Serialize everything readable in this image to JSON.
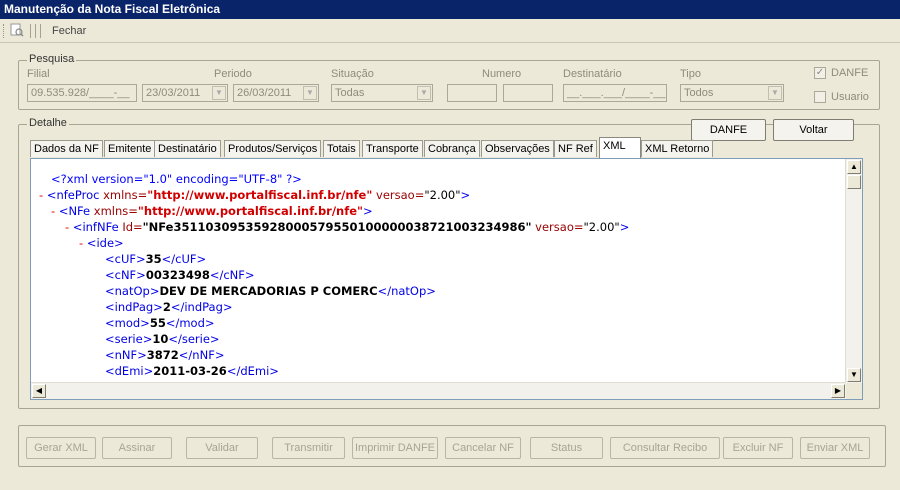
{
  "window": {
    "title": "Manutenção da Nota Fiscal Eletrônica"
  },
  "toolbar": {
    "close_label": "Fechar",
    "preview_icon": "print-preview-icon"
  },
  "pesquisa": {
    "legend": "Pesquisa",
    "filial_label": "Filial",
    "filial_value": "09.535.928/____-__",
    "periodo_label": "Periodo",
    "periodo_from": "23/03/2011",
    "periodo_to": "26/03/2011",
    "situacao_label": "Situação",
    "situacao_value": "Todas",
    "numero_label": "Numero",
    "numero_from": "",
    "numero_to": "",
    "destinatario_label": "Destinatário",
    "destinatario_value": "__.___.___/____-__",
    "tipo_label": "Tipo",
    "tipo_value": "Todos",
    "danfe_label": "DANFE",
    "danfe_checked": true,
    "usuario_label": "Usuario",
    "usuario_checked": false
  },
  "detalhe": {
    "legend": "Detalhe",
    "danfe_button": "DANFE",
    "voltar_button": "Voltar",
    "tabs": [
      "Dados da NF",
      "Emitente",
      "Destinatário",
      "Produtos/Serviços",
      "Totais",
      "Transporte",
      "Cobrança",
      "Observações",
      "NF Ref",
      "XML",
      "XML Retorno"
    ],
    "active_tab": "XML"
  },
  "xml": {
    "decl": "<?xml version=\"1.0\" encoding=\"UTF-8\" ?>",
    "nfeProc": {
      "open": "<nfeProc",
      "xmlns_name": "xmlns=",
      "xmlns_val": "\"http://www.portalfiscal.inf.br/nfe\"",
      "versao_name": "versao=",
      "versao_val": "\"2.00\"",
      "close": ">"
    },
    "nfe": {
      "open": "<NFe",
      "xmlns_name": "xmlns=",
      "xmlns_val": "\"http://www.portalfiscal.inf.br/nfe\"",
      "close": ">"
    },
    "infNFe": {
      "open": "<infNFe",
      "id_name": "Id=",
      "id_val": "\"NFe35110309535928000579550100000038721003234986\"",
      "versao_name": "versao=",
      "versao_val": "\"2.00\"",
      "close": ">"
    },
    "ide": "<ide>",
    "minus": "-",
    "fields": [
      {
        "open": "<cUF>",
        "value": "35",
        "close": "</cUF>"
      },
      {
        "open": "<cNF>",
        "value": "00323498",
        "close": "</cNF>"
      },
      {
        "open": "<natOp>",
        "value": "DEV DE MERCADORIAS P COMERC",
        "close": "</natOp>"
      },
      {
        "open": "<indPag>",
        "value": "2",
        "close": "</indPag>"
      },
      {
        "open": "<mod>",
        "value": "55",
        "close": "</mod>"
      },
      {
        "open": "<serie>",
        "value": "10",
        "close": "</serie>"
      },
      {
        "open": "<nNF>",
        "value": "3872",
        "close": "</nNF>"
      },
      {
        "open": "<dEmi>",
        "value": "2011-03-26",
        "close": "</dEmi>"
      }
    ]
  },
  "actions": [
    "Gerar XML",
    "Assinar",
    "Validar",
    "Transmitir",
    "Imprimir DANFE",
    "Cancelar NF",
    "Status",
    "Consultar Recibo",
    "Excluir NF",
    "Enviar XML"
  ]
}
